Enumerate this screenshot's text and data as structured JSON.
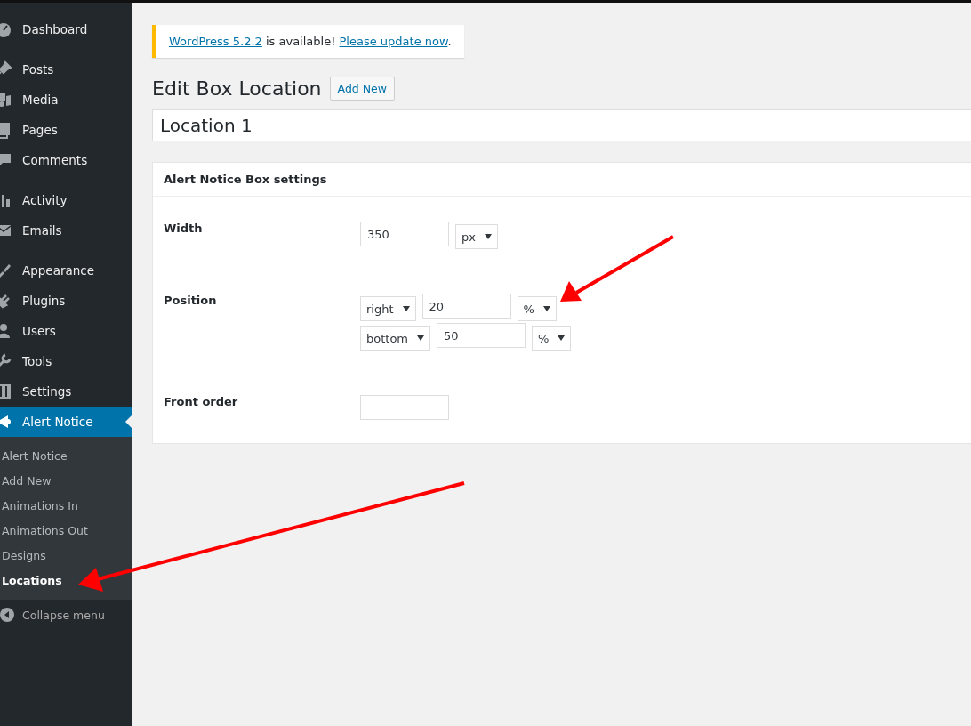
{
  "sidebar": {
    "groups": [
      [
        {
          "label": "Dashboard",
          "selected": false
        }
      ],
      [
        {
          "label": "Posts",
          "selected": false
        },
        {
          "label": "Media",
          "selected": false
        },
        {
          "label": "Pages",
          "selected": false
        },
        {
          "label": "Comments",
          "selected": false
        }
      ],
      [
        {
          "label": "Activity",
          "selected": false
        },
        {
          "label": "Emails",
          "selected": false
        }
      ],
      [
        {
          "label": "Appearance",
          "selected": false
        },
        {
          "label": "Plugins",
          "selected": false
        },
        {
          "label": "Users",
          "selected": false
        },
        {
          "label": "Tools",
          "selected": false
        },
        {
          "label": "Settings",
          "selected": false
        },
        {
          "label": "Alert Notice",
          "selected": true,
          "submenu": [
            {
              "label": "Alert Notice",
              "selected": false
            },
            {
              "label": "Add New",
              "selected": false
            },
            {
              "label": "Animations In",
              "selected": false
            },
            {
              "label": "Animations Out",
              "selected": false
            },
            {
              "label": "Designs",
              "selected": false
            },
            {
              "label": "Locations",
              "selected": true
            }
          ]
        }
      ]
    ],
    "collapse": "Collapse menu"
  },
  "notice": {
    "parts": [
      {
        "kind": "link",
        "text": "WordPress 5.2.2"
      },
      {
        "kind": "text",
        "text": " is available! "
      },
      {
        "kind": "link",
        "text": "Please update now"
      },
      {
        "kind": "text",
        "text": "."
      }
    ]
  },
  "heading": "Edit Box Location",
  "add_new": "Add New",
  "title_value": "Location 1",
  "settings": {
    "title": "Alert Notice Box settings",
    "rows": [
      {
        "label": "Width",
        "lines": [
          [
            {
              "kind": "input",
              "value": "350"
            },
            {
              "kind": "select",
              "value": "px"
            }
          ]
        ]
      },
      {
        "label": "Position",
        "lines": [
          [
            {
              "kind": "select",
              "value": "right"
            },
            {
              "kind": "input",
              "value": "20"
            },
            {
              "kind": "select",
              "value": "%"
            }
          ],
          [
            {
              "kind": "select",
              "value": "bottom"
            },
            {
              "kind": "input",
              "value": "50"
            },
            {
              "kind": "select",
              "value": "%"
            }
          ]
        ]
      },
      {
        "label": "Front order",
        "lines": [
          [
            {
              "kind": "input"
            }
          ]
        ]
      }
    ]
  }
}
